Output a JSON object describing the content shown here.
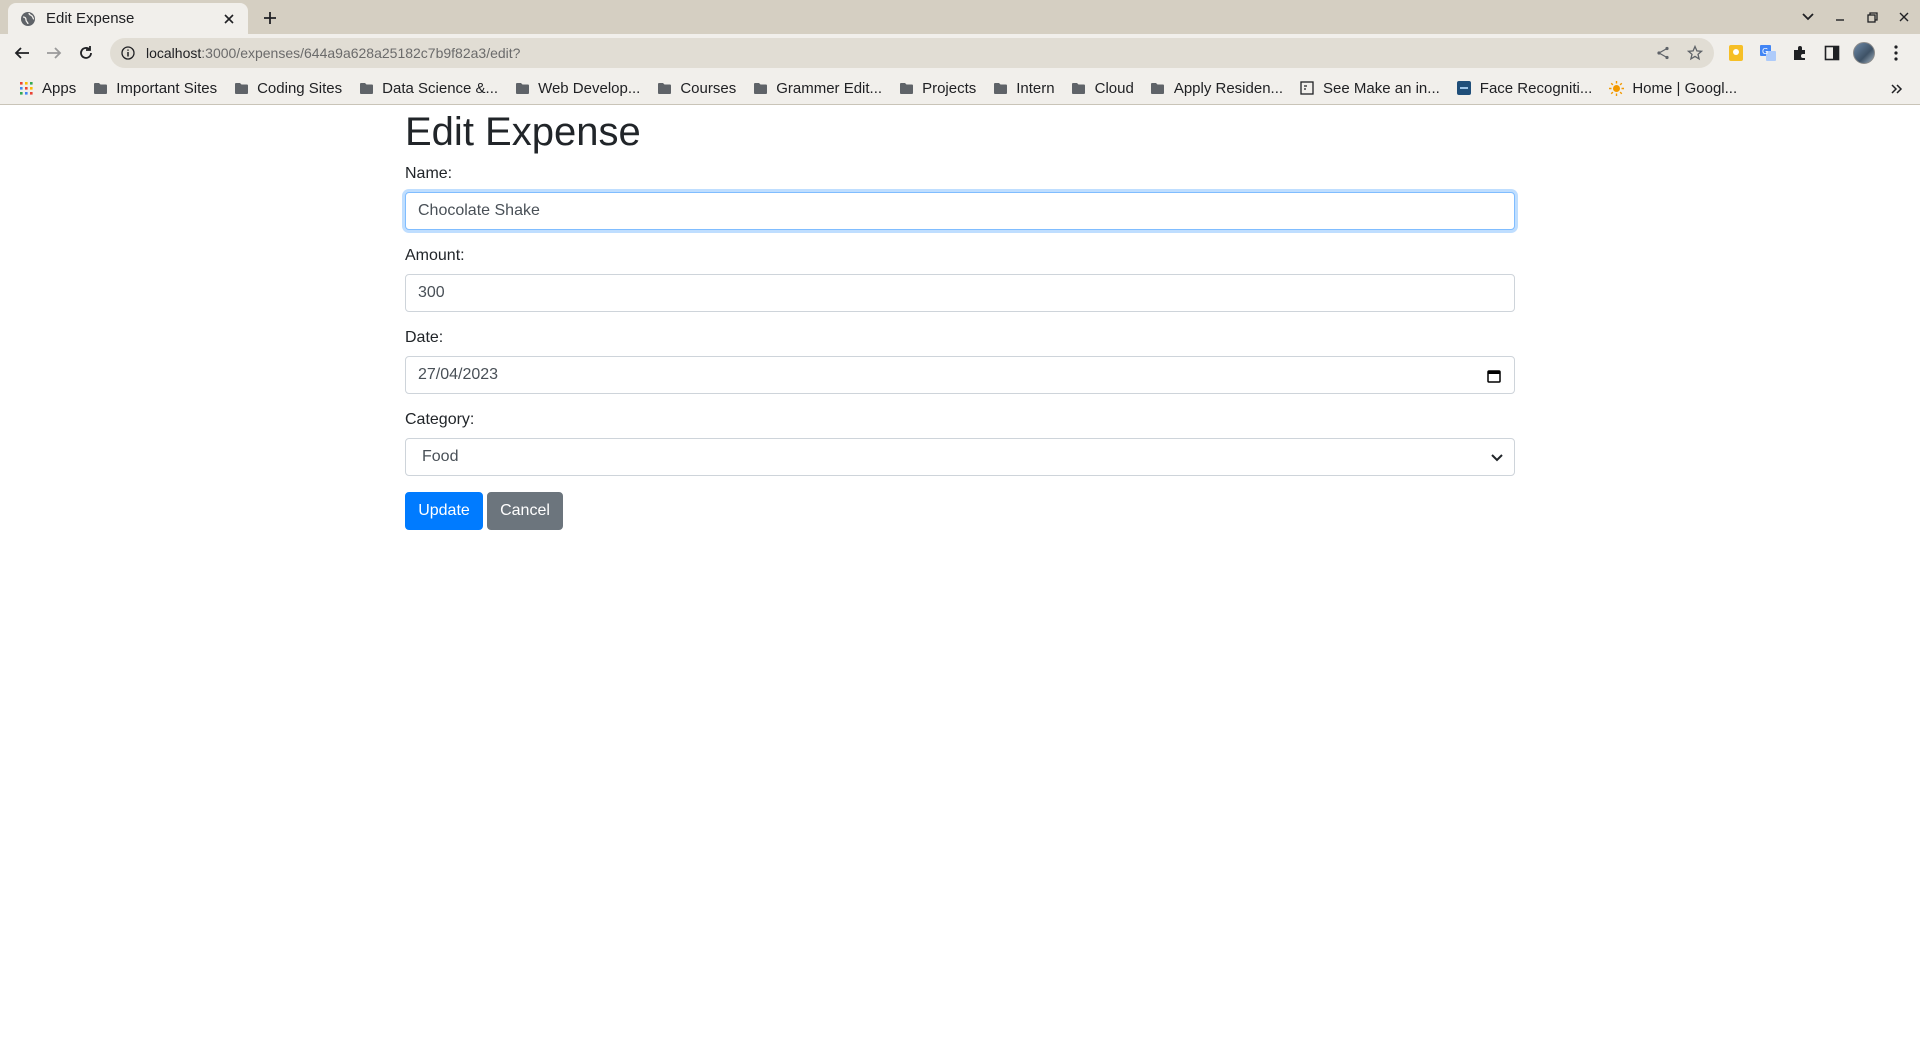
{
  "browser": {
    "tab_title": "Edit Expense",
    "url_host": "localhost",
    "url_path": ":3000/expenses/644a9a628a25182c7b9f82a3/edit?",
    "bookmarks": [
      {
        "label": "Apps",
        "icon": "apps-grid-icon"
      },
      {
        "label": "Important Sites",
        "icon": "folder-icon"
      },
      {
        "label": "Coding Sites",
        "icon": "folder-icon"
      },
      {
        "label": "Data Science &...",
        "icon": "folder-icon"
      },
      {
        "label": "Web Develop...",
        "icon": "folder-icon"
      },
      {
        "label": "Courses",
        "icon": "folder-icon"
      },
      {
        "label": "Grammer Edit...",
        "icon": "folder-icon"
      },
      {
        "label": "Projects",
        "icon": "folder-icon"
      },
      {
        "label": "Intern",
        "icon": "folder-icon"
      },
      {
        "label": "Cloud",
        "icon": "folder-icon"
      },
      {
        "label": "Apply Residen...",
        "icon": "folder-icon"
      },
      {
        "label": "See Make an in...",
        "icon": "page-icon"
      },
      {
        "label": "Face Recogniti...",
        "icon": "site-favicon"
      },
      {
        "label": "Home | Googl...",
        "icon": "sun-favicon"
      }
    ]
  },
  "form": {
    "title": "Edit Expense",
    "name_label": "Name:",
    "name_value": "Chocolate Shake",
    "amount_label": "Amount:",
    "amount_value": "300",
    "date_label": "Date:",
    "date_value": "27/04/2023",
    "category_label": "Category:",
    "category_value": "Food",
    "update_label": "Update",
    "cancel_label": "Cancel"
  },
  "colors": {
    "primary": "#007bff",
    "secondary": "#6c757d",
    "focus_border": "#80bdff"
  }
}
